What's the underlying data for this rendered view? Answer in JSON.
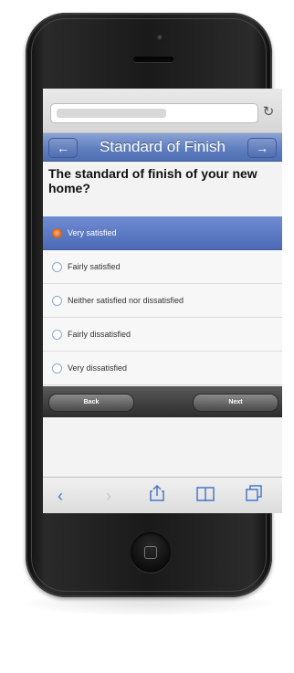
{
  "header": {
    "title": "Standard of Finish",
    "back_icon": "arrow-left-icon",
    "next_icon": "arrow-right-icon"
  },
  "question": {
    "text": "The standard of finish of your new home?"
  },
  "options": [
    {
      "label": "Very satisfied",
      "selected": true
    },
    {
      "label": "Fairly satisfied",
      "selected": false
    },
    {
      "label": "Neither satisfied nor dissatisfied",
      "selected": false
    },
    {
      "label": "Fairly dissatisfied",
      "selected": false
    },
    {
      "label": "Very dissatisfied",
      "selected": false
    }
  ],
  "footer": {
    "back_label": "Back",
    "next_label": "Next"
  },
  "colors": {
    "accent": "#5f7fc0",
    "selected_radio": "#e06a20"
  }
}
